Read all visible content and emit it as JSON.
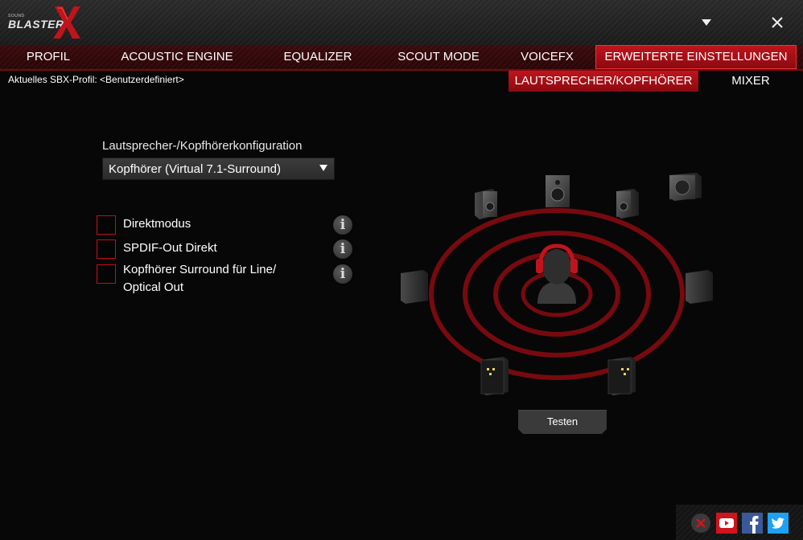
{
  "app": {
    "logo_small": "SOUND",
    "logo_text": "BLASTER",
    "accent_color": "#c0141c"
  },
  "window_controls": {
    "menu_icon": "chevron-down-icon",
    "close_icon": "close-icon"
  },
  "tabs": [
    {
      "label": "PROFIL"
    },
    {
      "label": "ACOUSTIC ENGINE"
    },
    {
      "label": "EQUALIZER"
    },
    {
      "label": "SCOUT MODE"
    },
    {
      "label": "VOICEFX"
    },
    {
      "label": "ERWEITERTE EINSTELLUNGEN",
      "active": true
    }
  ],
  "profile": {
    "label": "Aktuelles SBX-Profil: <Benutzerdefiniert>"
  },
  "subtabs": [
    {
      "label": "LAUTSPRECHER/KOPFHÖRER",
      "active": true
    },
    {
      "label": "MIXER"
    }
  ],
  "config": {
    "label": "Lautsprecher-/Kopfhörerkonfiguration",
    "selected": "Kopfhörer (Virtual 7.1-Surround)"
  },
  "options": [
    {
      "label": "Direktmodus",
      "checked": false
    },
    {
      "label": "SPDIF-Out Direkt",
      "checked": false
    },
    {
      "label_line1": "Kopfhörer Surround für Line/",
      "label_line2": "Optical Out",
      "checked": false
    }
  ],
  "test_button": {
    "label": "Testen"
  },
  "social": [
    "close-icon",
    "youtube-icon",
    "facebook-icon",
    "twitter-icon"
  ]
}
